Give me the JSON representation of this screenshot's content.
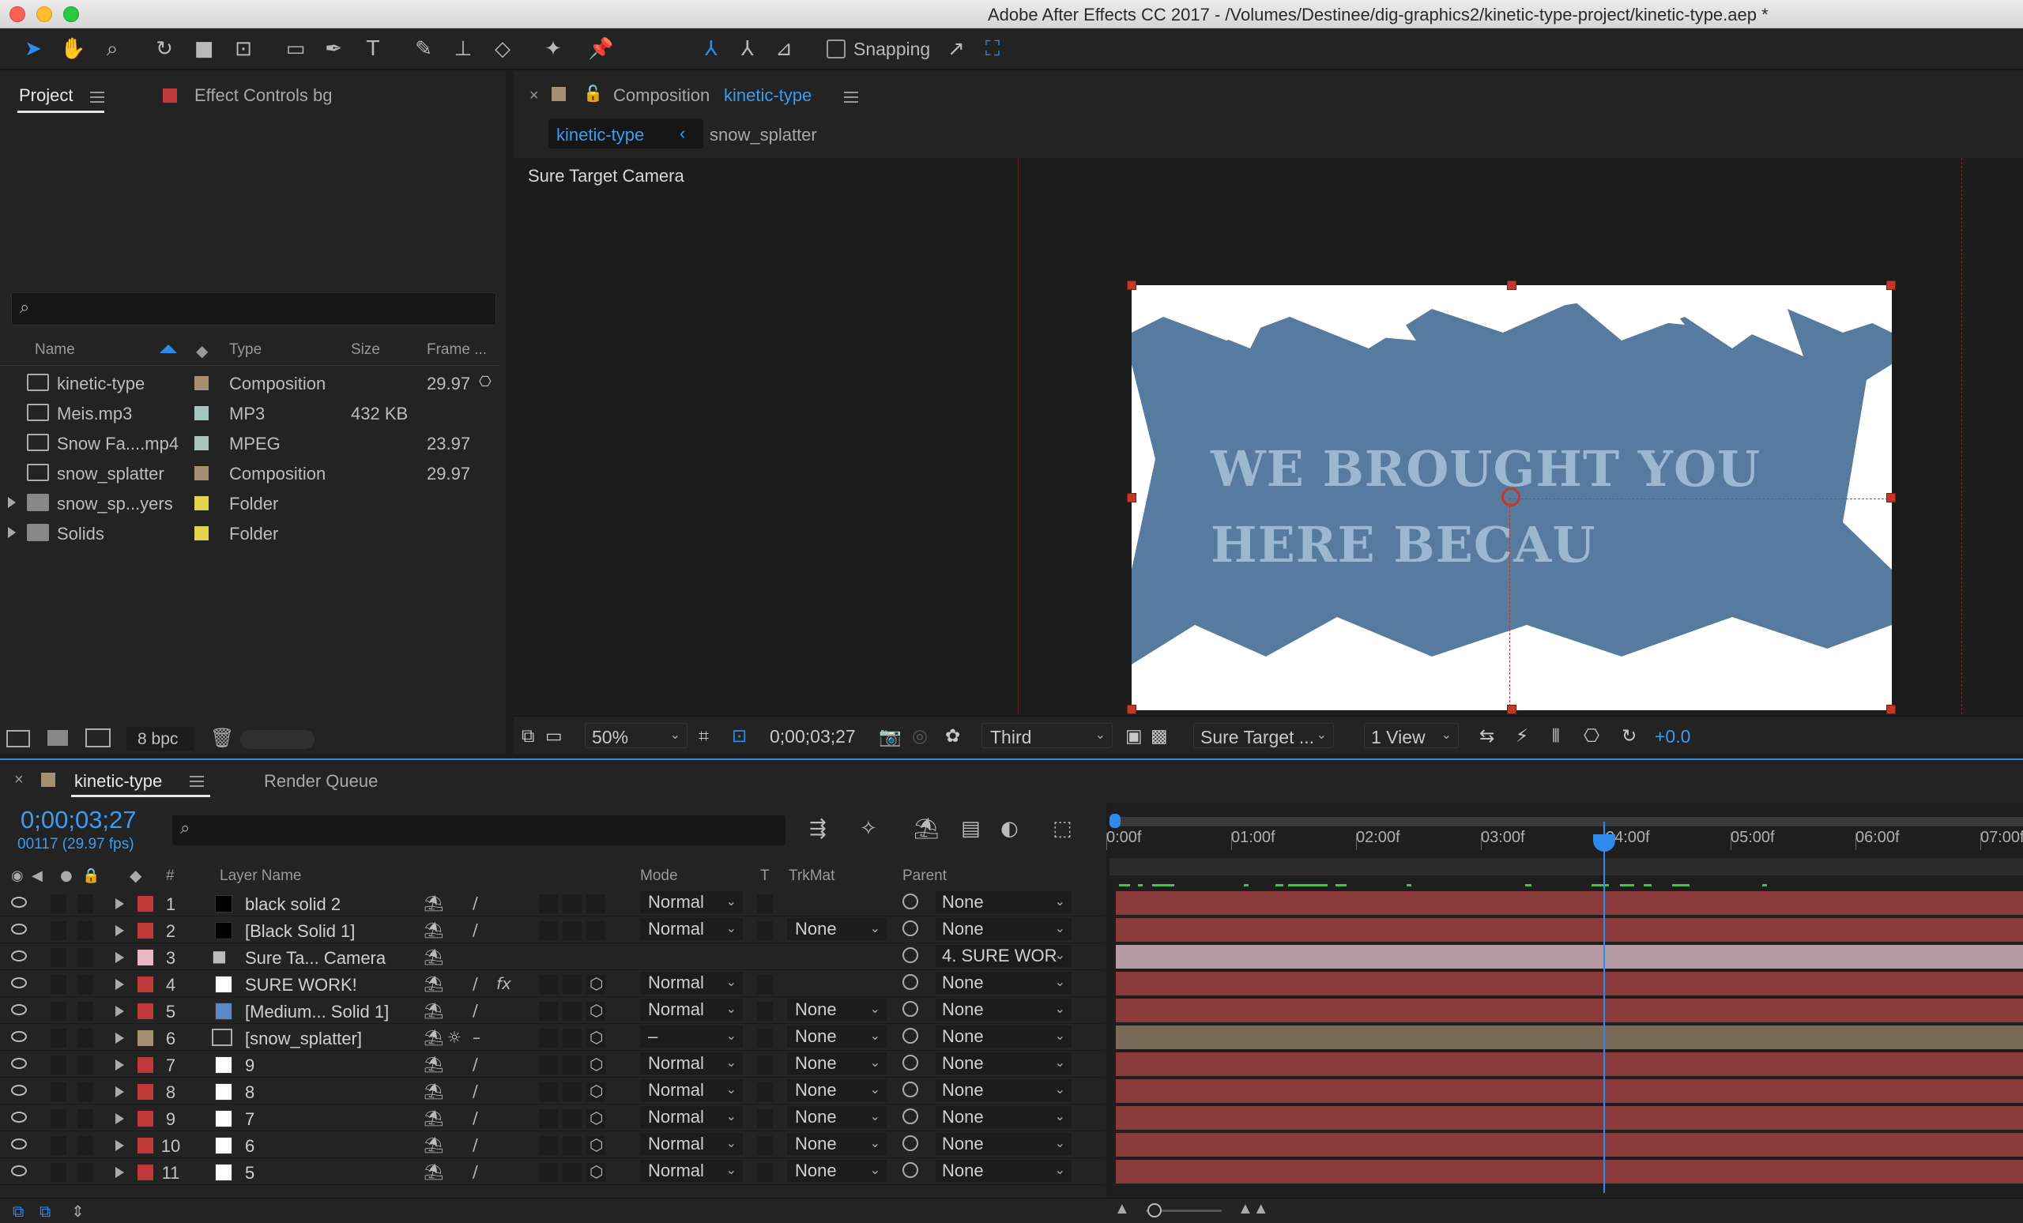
{
  "window": {
    "title": "Adobe After Effects CC 2017 - /Volumes/Destinee/dig-graphics2/kinetic-type-project/kinetic-type.aep *"
  },
  "toolbar": {
    "snapping_label": "Snapping"
  },
  "project_panel": {
    "tab_project": "Project",
    "tab_effect_controls": "Effect Controls bg",
    "columns": {
      "name": "Name",
      "type": "Type",
      "size": "Size",
      "frame": "Frame ..."
    },
    "items": [
      {
        "name": "kinetic-type",
        "type": "Composition",
        "size": "",
        "frame": "29.97",
        "color": "#a48f73",
        "icon": "composition-icon"
      },
      {
        "name": "Meis.mp3",
        "type": "MP3",
        "size": "432 KB",
        "frame": "",
        "color": "#a8c6bf",
        "icon": "audio-file-icon"
      },
      {
        "name": "Snow Fa....mp4",
        "type": "MPEG",
        "size": "",
        "frame": "23.97",
        "color": "#a8c6bf",
        "icon": "video-file-icon"
      },
      {
        "name": "snow_splatter",
        "type": "Composition",
        "size": "",
        "frame": "29.97",
        "color": "#a48f73",
        "icon": "composition-icon"
      },
      {
        "name": "snow_sp...yers",
        "type": "Folder",
        "size": "",
        "frame": "",
        "color": "#e3d34e",
        "icon": "folder-icon"
      },
      {
        "name": "Solids",
        "type": "Folder",
        "size": "",
        "frame": "",
        "color": "#e3d34e",
        "icon": "folder-icon"
      }
    ],
    "footer_bpc": "8 bpc"
  },
  "composition_panel": {
    "tab_prefix": "Composition",
    "tab_name": "kinetic-type",
    "breadcrumb_active": "kinetic-type",
    "breadcrumb_other": "snow_splatter",
    "camera_label": "Sure Target Camera",
    "comp_text_line1": "WE BROUGHT YOU",
    "comp_text_line2": "HERE BECAU",
    "footer": {
      "zoom": "50%",
      "timecode": "0;00;03;27",
      "resolution": "Third",
      "camera": "Sure Target ...",
      "views": "1 View",
      "exposure": "+0.0"
    }
  },
  "timeline": {
    "tab_comp": "kinetic-type",
    "tab_render_queue": "Render Queue",
    "current_time": "0;00;03;27",
    "frame_info": "00117 (29.97 fps)",
    "columns": {
      "num": "#",
      "layer_name": "Layer Name",
      "mode": "Mode",
      "t": "T",
      "trkmat": "TrkMat",
      "parent": "Parent"
    },
    "ruler": [
      "0:00f",
      "01:00f",
      "02:00f",
      "03:00f",
      "04:00f",
      "05:00f",
      "06:00f",
      "07:00f"
    ],
    "current_time_fraction": 0.53,
    "layers": [
      {
        "num": "1",
        "name": "black solid 2",
        "label": "#c0393a",
        "src": "#000000",
        "mode": "Normal",
        "trkmat": "",
        "parent": "None",
        "bar": "#8b3a3c"
      },
      {
        "num": "2",
        "name": "[Black Solid 1]",
        "label": "#c0393a",
        "src": "#000000",
        "mode": "Normal",
        "trkmat": "None",
        "parent": "None",
        "bar": "#8b3a3c"
      },
      {
        "num": "3",
        "name": "Sure Ta... Camera",
        "label": "#e8b7c4",
        "src": "",
        "mode": "",
        "trkmat": "",
        "parent": "4. SURE WOR",
        "bar": "#b59aa3"
      },
      {
        "num": "4",
        "name": "SURE WORK!",
        "label": "#c0393a",
        "src": "#ffffff",
        "mode": "Normal",
        "trkmat": "",
        "parent": "None",
        "bar": "#8b3a3c"
      },
      {
        "num": "5",
        "name": "[Medium... Solid 1]",
        "label": "#c0393a",
        "src": "#5b87c2",
        "mode": "Normal",
        "trkmat": "None",
        "parent": "None",
        "bar": "#8b3a3c"
      },
      {
        "num": "6",
        "name": "[snow_splatter]",
        "label": "#a48f73",
        "src": "",
        "mode": "–",
        "trkmat": "None",
        "parent": "None",
        "bar": "#7a6a58"
      },
      {
        "num": "7",
        "name": "9",
        "label": "#c0393a",
        "src": "#ffffff",
        "mode": "Normal",
        "trkmat": "None",
        "parent": "None",
        "bar": "#8b3a3c"
      },
      {
        "num": "8",
        "name": "8",
        "label": "#c0393a",
        "src": "#ffffff",
        "mode": "Normal",
        "trkmat": "None",
        "parent": "None",
        "bar": "#8b3a3c"
      },
      {
        "num": "9",
        "name": "7",
        "label": "#c0393a",
        "src": "#ffffff",
        "mode": "Normal",
        "trkmat": "None",
        "parent": "None",
        "bar": "#8b3a3c"
      },
      {
        "num": "10",
        "name": "6",
        "label": "#c0393a",
        "src": "#ffffff",
        "mode": "Normal",
        "trkmat": "None",
        "parent": "None",
        "bar": "#8b3a3c"
      },
      {
        "num": "11",
        "name": "5",
        "label": "#c0393a",
        "src": "#ffffff",
        "mode": "Normal",
        "trkmat": "None",
        "parent": "None",
        "bar": "#8b3a3c"
      }
    ]
  },
  "colors": {
    "accent": "#2d8ceb",
    "comp_blue": "#567b9e"
  }
}
